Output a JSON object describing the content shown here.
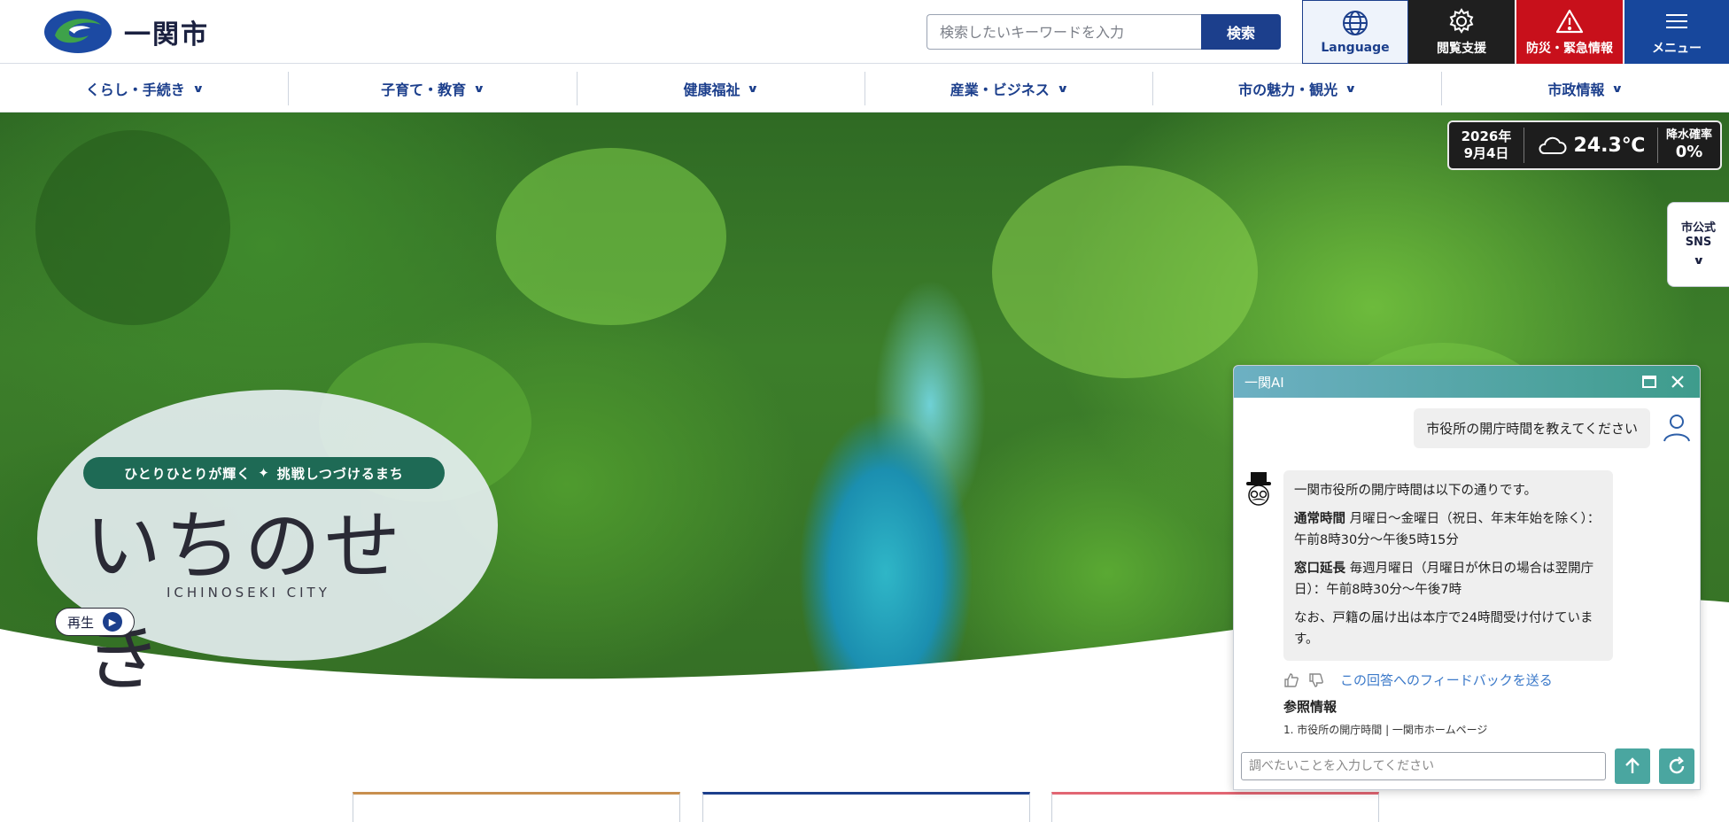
{
  "header": {
    "logo_text": "一関市",
    "search_placeholder": "検索したいキーワードを入力",
    "search_button": "検索",
    "buttons": [
      {
        "label": "Language",
        "icon": "globe-icon"
      },
      {
        "label": "閲覧支援",
        "icon": "gear-icon"
      },
      {
        "label": "防災・緊急情報",
        "icon": "warning-icon"
      },
      {
        "label": "メニュー",
        "icon": "hamburger-icon"
      }
    ]
  },
  "nav": {
    "items": [
      "くらし・手続き",
      "子育て・教育",
      "健康福祉",
      "産業・ビジネス",
      "市の魅力・観光",
      "市政情報"
    ]
  },
  "weather": {
    "year": "2026年",
    "date": "9月4日",
    "temperature": "24.3℃",
    "rain_label": "降水確率",
    "rain_value": "0%",
    "icon": "cloud-icon"
  },
  "sns": {
    "label_line1": "市公式",
    "label_line2": "SNS"
  },
  "hero": {
    "catch_left": "ひとりひとりが輝く",
    "catch_right": "挑戦しつづけるまち",
    "city_name_jp": "いちのせき",
    "city_name_en": "ICHINOSEKI CITY",
    "play_label": "再生"
  },
  "chat": {
    "title": "一関AI",
    "user_message": "市役所の開庁時間を教えてください",
    "bot_intro": "一関市役所の開庁時間は以下の通りです。",
    "bot_item1_label": "通常時間",
    "bot_item1_text": " 月曜日～金曜日（祝日、年末年始を除く）：午前8時30分～午後5時15分",
    "bot_item2_label": "窓口延長",
    "bot_item2_text": " 毎週月曜日（月曜日が休日の場合は翌開庁日）：午前8時30分～午後7時",
    "bot_note": "なお、戸籍の届け出は本庁で24時間受け付けています。",
    "feedback_link": "この回答へのフィードバックを送る",
    "ref_title": "参照情報",
    "ref_item": "1. 市役所の開庁時間 | 一関市ホームページ",
    "input_placeholder": "調べたいことを入力してください"
  },
  "colors": {
    "brand_blue": "#1c3f8c",
    "disaster_red": "#c8101b",
    "menu_blue": "#17479c",
    "chat_teal": "#4aa6a0"
  }
}
